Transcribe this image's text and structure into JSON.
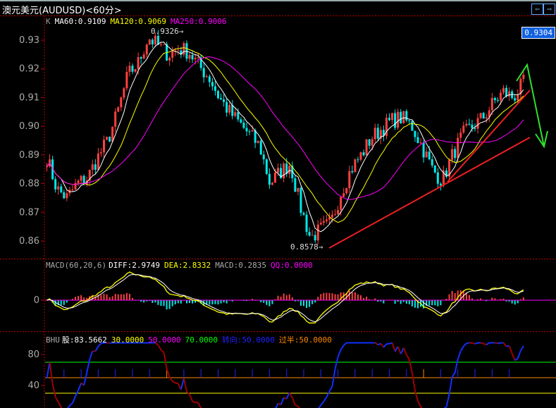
{
  "window": {
    "title": "澳元美元(AUDUSD)<60分>",
    "nav_prev": "⇦",
    "nav_next": "⇨"
  },
  "price_panel": {
    "label": "K",
    "ma60": "MA60:0.9109",
    "ma120": "MA120:0.9069",
    "ma250": "MA250:0.9006",
    "last_price": "0.9304",
    "high_label": "0.9326→",
    "low_label": "0.8578→",
    "colors": {
      "up": "#ff4040",
      "down": "#00e8e8",
      "ma60": "#ffffff",
      "ma120": "#ffff00",
      "ma250": "#ff00ff"
    }
  },
  "macd_panel": {
    "name": "MACD(60,20,6)",
    "diff": "DIFF:2.9749",
    "dea": "DEA:2.8332",
    "macd": "MACD:0.2835",
    "qq": "QQ:0.0000"
  },
  "bhu_panel": {
    "name": "BHU",
    "stock": "股:83.5662",
    "l30": "30.0000",
    "l50": "50.0000",
    "l70": "70.0000",
    "turn": "转向:50.0000",
    "half": "过半:50.0000"
  },
  "chart_data": [
    {
      "type": "candlestick",
      "title": "澳元美元(AUDUSD)<60分>",
      "ylim": [
        0.855,
        0.935
      ],
      "yticks": [
        "0.93",
        "0.92",
        "0.91",
        "0.90",
        "0.89",
        "0.88",
        "0.87",
        "0.86"
      ],
      "close_path": [
        0.889,
        0.878,
        0.875,
        0.88,
        0.882,
        0.889,
        0.895,
        0.905,
        0.918,
        0.922,
        0.931,
        0.928,
        0.925,
        0.927,
        0.926,
        0.921,
        0.917,
        0.91,
        0.905,
        0.901,
        0.897,
        0.893,
        0.88,
        0.884,
        0.887,
        0.872,
        0.861,
        0.864,
        0.866,
        0.877,
        0.885,
        0.89,
        0.896,
        0.899,
        0.902,
        0.903,
        0.9,
        0.893,
        0.885,
        0.881,
        0.89,
        0.897,
        0.9,
        0.903,
        0.908,
        0.912,
        0.91,
        0.915
      ],
      "high": 0.9326,
      "low": 0.8578
    },
    {
      "type": "line",
      "title": "MACD(60,20,6)",
      "yticks": [
        "0"
      ]
    },
    {
      "type": "line",
      "title": "BHU",
      "yticks": [
        "80",
        "40"
      ],
      "levels": [
        30,
        50,
        70
      ]
    }
  ]
}
